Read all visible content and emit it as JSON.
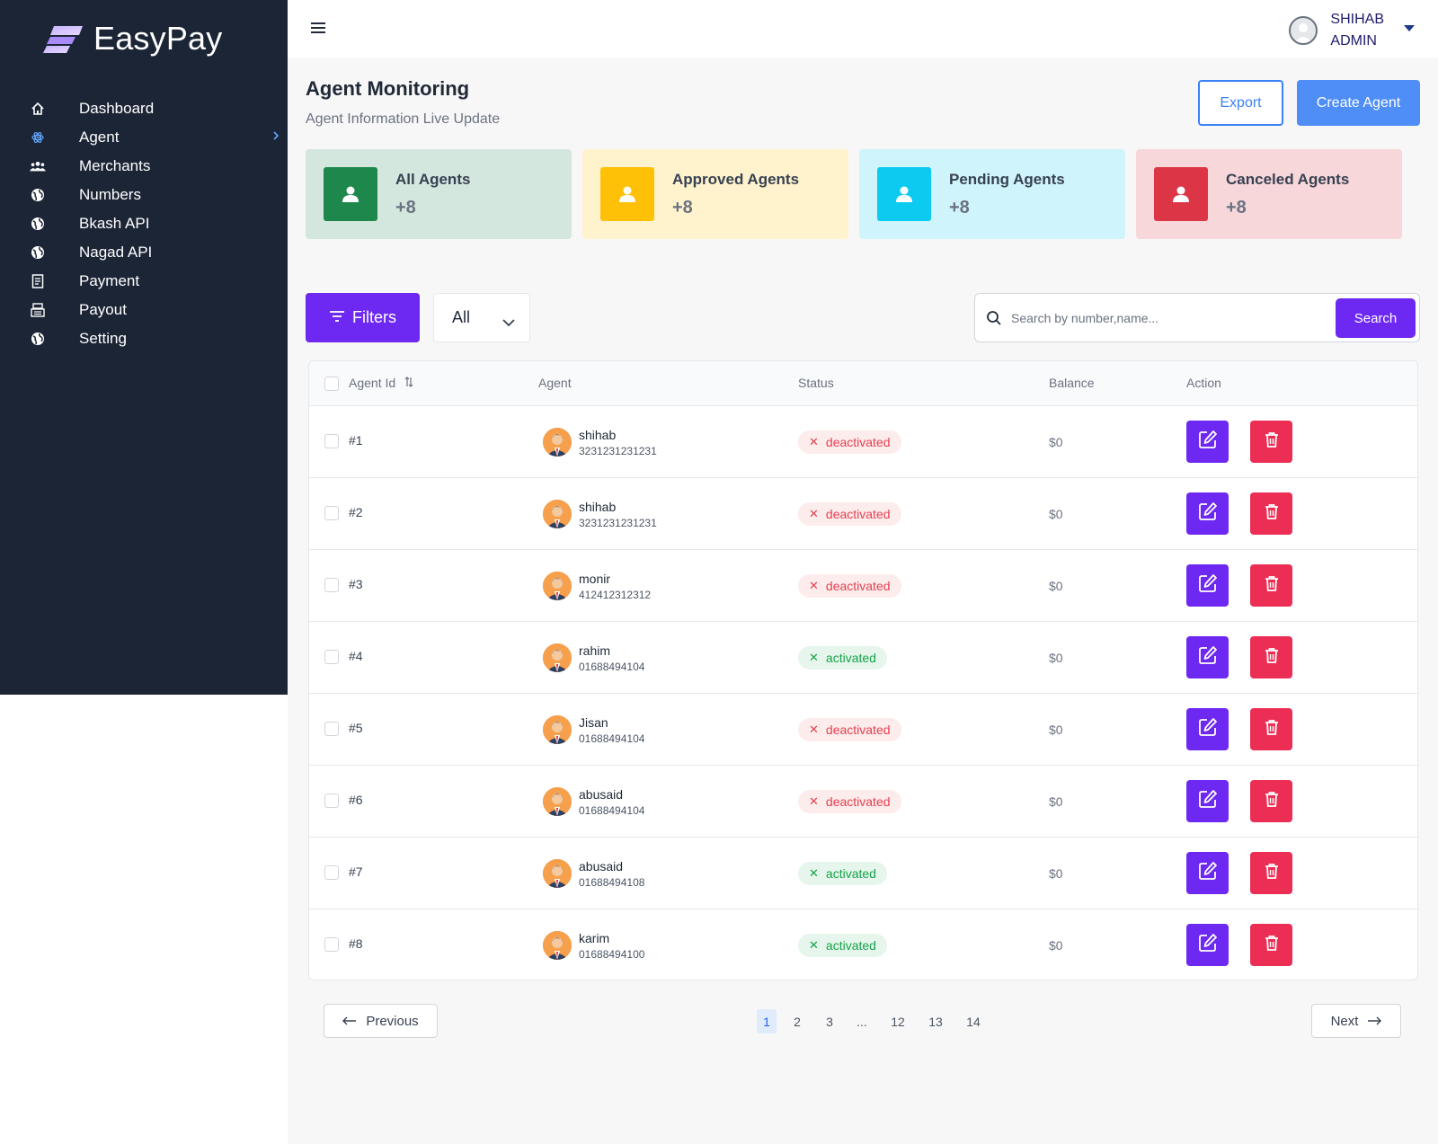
{
  "app": {
    "name": "EasyPay"
  },
  "sidebar": {
    "items": [
      {
        "label": "Dashboard",
        "icon": "home-icon"
      },
      {
        "label": "Agent",
        "icon": "atom-icon",
        "active": true
      },
      {
        "label": "Merchants",
        "icon": "users-icon"
      },
      {
        "label": "Numbers",
        "icon": "globe-icon"
      },
      {
        "label": "Bkash API",
        "icon": "globe-icon"
      },
      {
        "label": "Nagad API",
        "icon": "globe-icon"
      },
      {
        "label": "Payment",
        "icon": "receipt-icon"
      },
      {
        "label": "Payout",
        "icon": "register-icon"
      },
      {
        "label": "Setting",
        "icon": "globe-icon"
      }
    ]
  },
  "header": {
    "user_first": "SHIHAB",
    "user_second": "ADMIN"
  },
  "page": {
    "title": "Agent Monitoring",
    "subtitle": "Agent Information Live Update",
    "export_label": "Export",
    "create_label": "Create Agent"
  },
  "cards": [
    {
      "title": "All Agents",
      "value": "+8",
      "bg": "#d3e7df",
      "icon_bg": "#1e874b"
    },
    {
      "title": "Approved Agents",
      "value": "+8",
      "bg": "#fff3cd",
      "icon_bg": "#ffc107"
    },
    {
      "title": "Pending Agents",
      "value": "+8",
      "bg": "#cff4fc",
      "icon_bg": "#0dcaf0"
    },
    {
      "title": "Canceled Agents",
      "value": "+8",
      "bg": "#f8d7da",
      "icon_bg": "#dc3545"
    }
  ],
  "filters": {
    "filters_label": "Filters",
    "select_value": "All",
    "search_placeholder": "Search by number,name...",
    "search_button": "Search"
  },
  "table": {
    "headers": {
      "id": "Agent Id",
      "agent": "Agent",
      "status": "Status",
      "balance": "Balance",
      "action": "Action"
    },
    "rows": [
      {
        "id": "#1",
        "name": "shihab",
        "number": "3231231231231",
        "status": "deactivated",
        "balance": "$0"
      },
      {
        "id": "#2",
        "name": "shihab",
        "number": "3231231231231",
        "status": "deactivated",
        "balance": "$0"
      },
      {
        "id": "#3",
        "name": "monir",
        "number": "412412312312",
        "status": "deactivated",
        "balance": "$0"
      },
      {
        "id": "#4",
        "name": "rahim",
        "number": "01688494104",
        "status": "activated",
        "balance": "$0"
      },
      {
        "id": "#5",
        "name": "Jisan",
        "number": "01688494104",
        "status": "deactivated",
        "balance": "$0"
      },
      {
        "id": "#6",
        "name": "abusaid",
        "number": "01688494104",
        "status": "deactivated",
        "balance": "$0"
      },
      {
        "id": "#7",
        "name": "abusaid",
        "number": "01688494108",
        "status": "activated",
        "balance": "$0"
      },
      {
        "id": "#8",
        "name": "karim",
        "number": "01688494100",
        "status": "activated",
        "balance": "$0"
      }
    ]
  },
  "pagination": {
    "prev_label": "Previous",
    "next_label": "Next",
    "pages": [
      "1",
      "2",
      "3",
      "...",
      "12",
      "13",
      "14"
    ],
    "current": "1"
  }
}
